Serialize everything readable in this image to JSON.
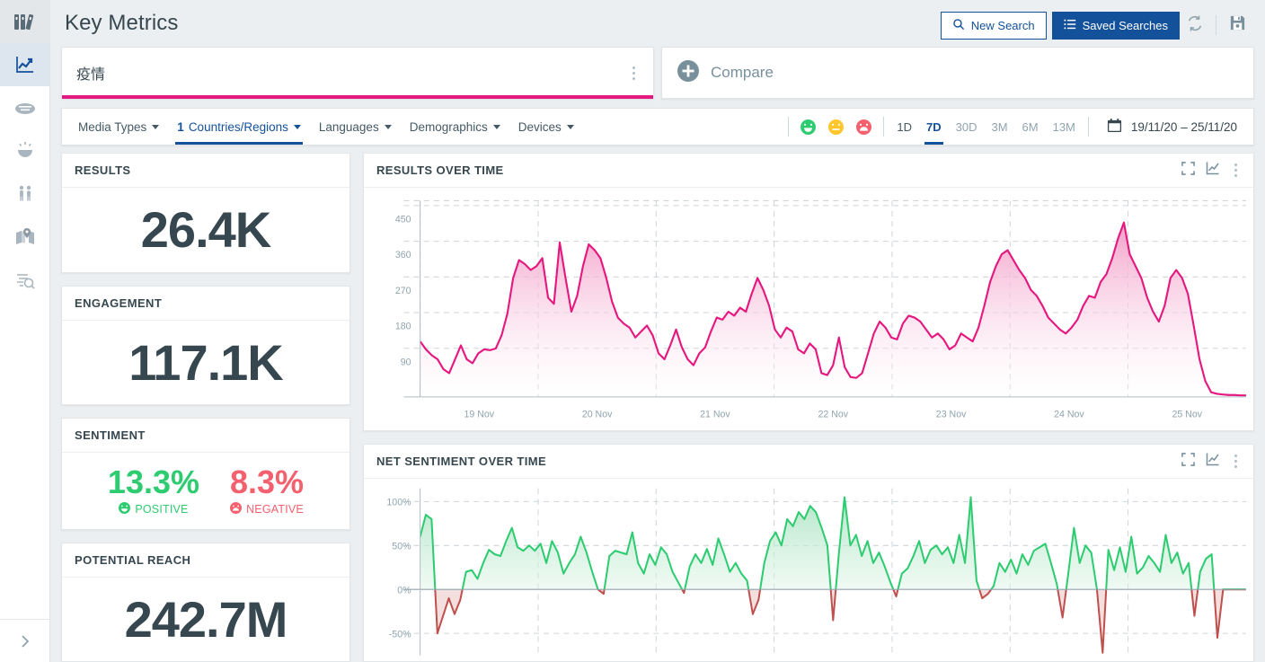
{
  "sidebar": {
    "logo_icon": "archive-books-icon",
    "items": [
      {
        "icon": "trending-chart-icon",
        "name": "sidebar-item-key-metrics",
        "active": true
      },
      {
        "icon": "cloud-icon",
        "name": "sidebar-item-word-cloud",
        "active": false
      },
      {
        "icon": "emotion-face-icon",
        "name": "sidebar-item-emotions",
        "active": false
      },
      {
        "icon": "demographics-people-icon",
        "name": "sidebar-item-demographics",
        "active": false
      },
      {
        "icon": "map-pin-icon",
        "name": "sidebar-item-geography",
        "active": false
      },
      {
        "icon": "mentions-search-icon",
        "name": "sidebar-item-mentions",
        "active": false
      }
    ],
    "expand_icon": "chevron-right-icon"
  },
  "header": {
    "title": "Key Metrics",
    "new_search_label": "New Search",
    "new_search_icon": "search-icon",
    "saved_searches_label": "Saved Searches",
    "saved_searches_icon": "list-icon",
    "refresh_icon": "refresh-icon",
    "save_icon": "floppy-save-icon"
  },
  "search": {
    "query": "疫情",
    "accent_color": "#e5187f",
    "menu_icon": "kebab-menu-icon",
    "compare_label": "Compare",
    "compare_icon": "plus-circle-icon"
  },
  "filters": {
    "items": [
      {
        "label": "Media Types",
        "count": "",
        "active": false
      },
      {
        "label": "Countries/Regions",
        "count": "1",
        "active": true
      },
      {
        "label": "Languages",
        "count": "",
        "active": false
      },
      {
        "label": "Demographics",
        "count": "",
        "active": false
      },
      {
        "label": "Devices",
        "count": "",
        "active": false
      }
    ],
    "sentiment_icons": [
      {
        "name": "sentiment-positive-icon",
        "color": "#2ecc71"
      },
      {
        "name": "sentiment-neutral-icon",
        "color": "#ffc72c"
      },
      {
        "name": "sentiment-negative-icon",
        "color": "#f4606e"
      }
    ],
    "ranges": [
      {
        "label": "1D",
        "state": "enabled"
      },
      {
        "label": "7D",
        "state": "active"
      },
      {
        "label": "30D",
        "state": "disabled"
      },
      {
        "label": "3M",
        "state": "disabled"
      },
      {
        "label": "6M",
        "state": "disabled"
      },
      {
        "label": "13M",
        "state": "disabled"
      }
    ],
    "date_range": "19/11/20 – 25/11/20",
    "calendar_icon": "calendar-icon"
  },
  "metrics": {
    "results": {
      "title": "RESULTS",
      "value": "26.4K"
    },
    "engagement": {
      "title": "ENGAGEMENT",
      "value": "117.1K"
    },
    "sentiment": {
      "title": "SENTIMENT",
      "positive_value": "13.3%",
      "positive_label": "POSITIVE",
      "positive_icon": "sentiment-positive-icon",
      "negative_value": "8.3%",
      "negative_label": "NEGATIVE",
      "negative_icon": "sentiment-negative-icon"
    },
    "potential_reach": {
      "title": "POTENTIAL REACH",
      "value": "242.7M"
    }
  },
  "panels": {
    "results_over_time": {
      "title": "RESULTS OVER TIME",
      "expand_icon": "fullscreen-icon",
      "chart_type_icon": "line-chart-icon",
      "menu_icon": "kebab-menu-icon"
    },
    "net_sentiment_over_time": {
      "title": "NET SENTIMENT OVER TIME",
      "expand_icon": "fullscreen-icon",
      "chart_type_icon": "line-chart-icon",
      "menu_icon": "kebab-menu-icon"
    }
  },
  "chart_data": [
    {
      "type": "area",
      "id": "results-over-time",
      "title": "RESULTS OVER TIME",
      "xlabel": "",
      "ylabel": "",
      "grid": true,
      "legend": null,
      "line_color": "#e5187f",
      "fill_gradient": [
        "#f29ac5",
        "#ffffff"
      ],
      "ylim": [
        0,
        495
      ],
      "yticks": [
        90,
        180,
        270,
        360,
        450
      ],
      "ytick_labels": [
        "90",
        "180",
        "270",
        "360",
        "450"
      ],
      "xticks": [
        "19 Nov",
        "20 Nov",
        "21 Nov",
        "22 Nov",
        "23 Nov",
        "24 Nov",
        "25 Nov"
      ],
      "x_start": "19 Nov",
      "x_end": "25 Nov",
      "values": [
        140,
        120,
        105,
        95,
        70,
        60,
        95,
        130,
        95,
        85,
        110,
        120,
        118,
        122,
        155,
        210,
        300,
        345,
        335,
        320,
        330,
        350,
        250,
        235,
        390,
        300,
        215,
        255,
        330,
        385,
        370,
        350,
        300,
        240,
        200,
        185,
        175,
        150,
        165,
        180,
        155,
        110,
        95,
        130,
        170,
        125,
        95,
        80,
        110,
        125,
        165,
        200,
        195,
        215,
        205,
        225,
        215,
        260,
        300,
        270,
        230,
        170,
        150,
        175,
        165,
        120,
        110,
        135,
        120,
        60,
        55,
        80,
        150,
        75,
        50,
        48,
        60,
        110,
        160,
        190,
        175,
        150,
        145,
        185,
        205,
        200,
        190,
        170,
        150,
        160,
        145,
        120,
        130,
        160,
        150,
        140,
        175,
        230,
        290,
        330,
        360,
        370,
        345,
        320,
        300,
        270,
        255,
        230,
        200,
        185,
        170,
        160,
        175,
        195,
        230,
        255,
        250,
        290,
        310,
        350,
        400,
        440,
        360,
        330,
        300,
        250,
        215,
        190,
        230,
        300,
        320,
        300,
        260,
        180,
        95,
        40,
        12,
        8,
        6,
        5,
        5,
        4,
        4
      ]
    },
    {
      "type": "area",
      "id": "net-sentiment-over-time",
      "title": "NET SENTIMENT OVER TIME",
      "xlabel": "",
      "ylabel": "",
      "grid": true,
      "legend": null,
      "positive_color": "#2ecc71",
      "negative_color": "#c0504d",
      "fill_gradient": [
        "#a9e3c0",
        "#ffffff"
      ],
      "ylim": [
        -75,
        115
      ],
      "yticks": [
        -50,
        0,
        50,
        100
      ],
      "ytick_labels": [
        "-50%",
        "0%",
        "50%",
        "100%"
      ],
      "zero_line": 0,
      "values": [
        60,
        85,
        80,
        -50,
        -30,
        -10,
        -28,
        -12,
        20,
        22,
        12,
        30,
        45,
        40,
        38,
        55,
        70,
        48,
        44,
        50,
        44,
        52,
        30,
        55,
        42,
        18,
        30,
        40,
        60,
        42,
        20,
        0,
        -5,
        38,
        44,
        42,
        40,
        65,
        30,
        18,
        40,
        28,
        48,
        40,
        20,
        8,
        -4,
        26,
        40,
        30,
        46,
        28,
        58,
        40,
        20,
        30,
        18,
        10,
        -28,
        -12,
        30,
        55,
        65,
        50,
        80,
        72,
        88,
        80,
        95,
        88,
        70,
        50,
        -35,
        40,
        105,
        50,
        62,
        38,
        55,
        30,
        42,
        26,
        8,
        -8,
        18,
        24,
        38,
        55,
        30,
        45,
        50,
        40,
        48,
        30,
        62,
        30,
        105,
        10,
        -10,
        -5,
        4,
        30,
        20,
        34,
        18,
        40,
        28,
        44,
        48,
        52,
        30,
        6,
        -32,
        18,
        70,
        30,
        50,
        42,
        0,
        -72,
        45,
        22,
        48,
        20,
        60,
        18,
        25,
        38,
        30,
        20,
        62,
        30,
        42,
        18,
        30,
        -30,
        20,
        35,
        40,
        -55,
        0,
        0,
        0,
        0,
        0
      ]
    }
  ]
}
